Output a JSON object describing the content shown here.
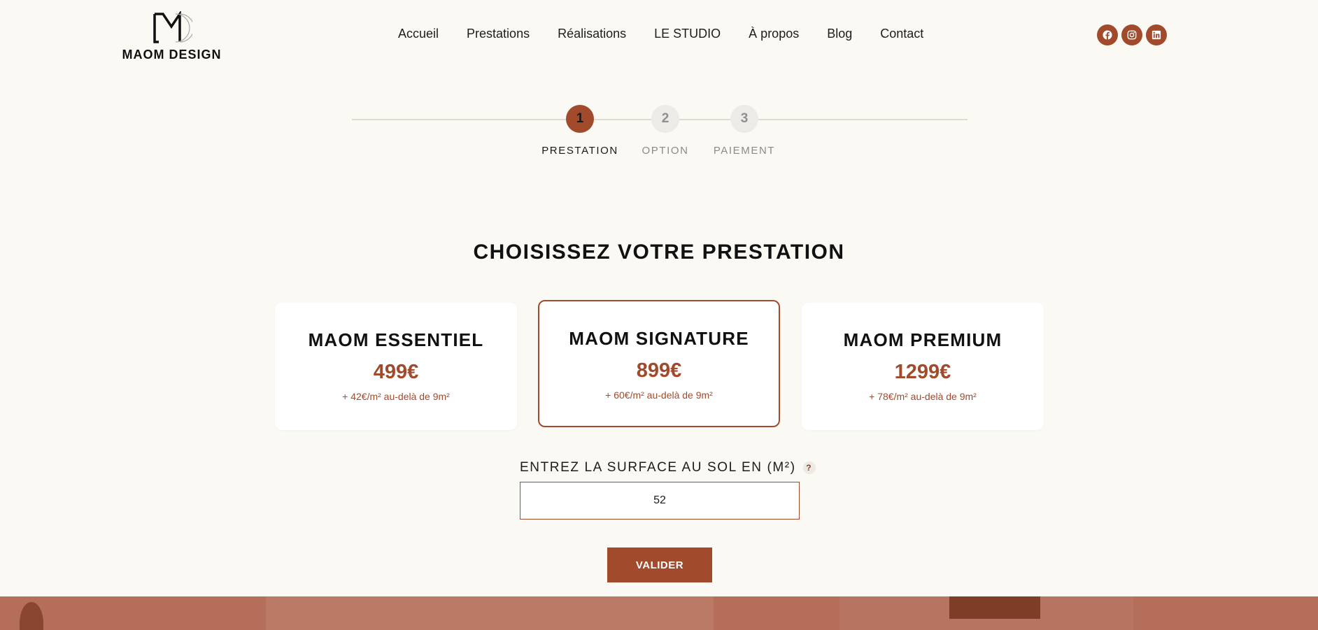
{
  "brand": {
    "name": "MAOM DESIGN"
  },
  "nav": {
    "items": [
      {
        "label": "Accueil"
      },
      {
        "label": "Prestations"
      },
      {
        "label": "Réalisations"
      },
      {
        "label": "LE STUDIO"
      },
      {
        "label": "À propos"
      },
      {
        "label": "Blog"
      },
      {
        "label": "Contact"
      }
    ]
  },
  "social": {
    "icons": [
      "facebook-icon",
      "instagram-icon",
      "linkedin-icon"
    ]
  },
  "stepper": {
    "current": 1,
    "steps": [
      {
        "number": "1",
        "label": "PRESTATION"
      },
      {
        "number": "2",
        "label": "OPTION"
      },
      {
        "number": "3",
        "label": "PAIEMENT"
      }
    ]
  },
  "main": {
    "title": "CHOISISSEZ VOTRE PRESTATION",
    "cards": [
      {
        "name": "MAOM ESSENTIEL",
        "price": "499€",
        "extra": "+ 42€/m² au-delà de 9m²"
      },
      {
        "name": "MAOM SIGNATURE",
        "price": "899€",
        "extra": "+ 60€/m² au-delà de 9m²"
      },
      {
        "name": "MAOM PREMIUM",
        "price": "1299€",
        "extra": "+ 78€/m² au-delà de 9m²"
      }
    ],
    "selected_card": "MAOM SIGNATURE",
    "surface": {
      "label": "ENTREZ LA SURFACE AU SOL EN (M²)",
      "help": "?",
      "value": "52"
    },
    "validate_label": "VALIDER"
  },
  "colors": {
    "accent": "#a14a2c",
    "background": "#fbf9f4",
    "card": "#ffffff"
  }
}
